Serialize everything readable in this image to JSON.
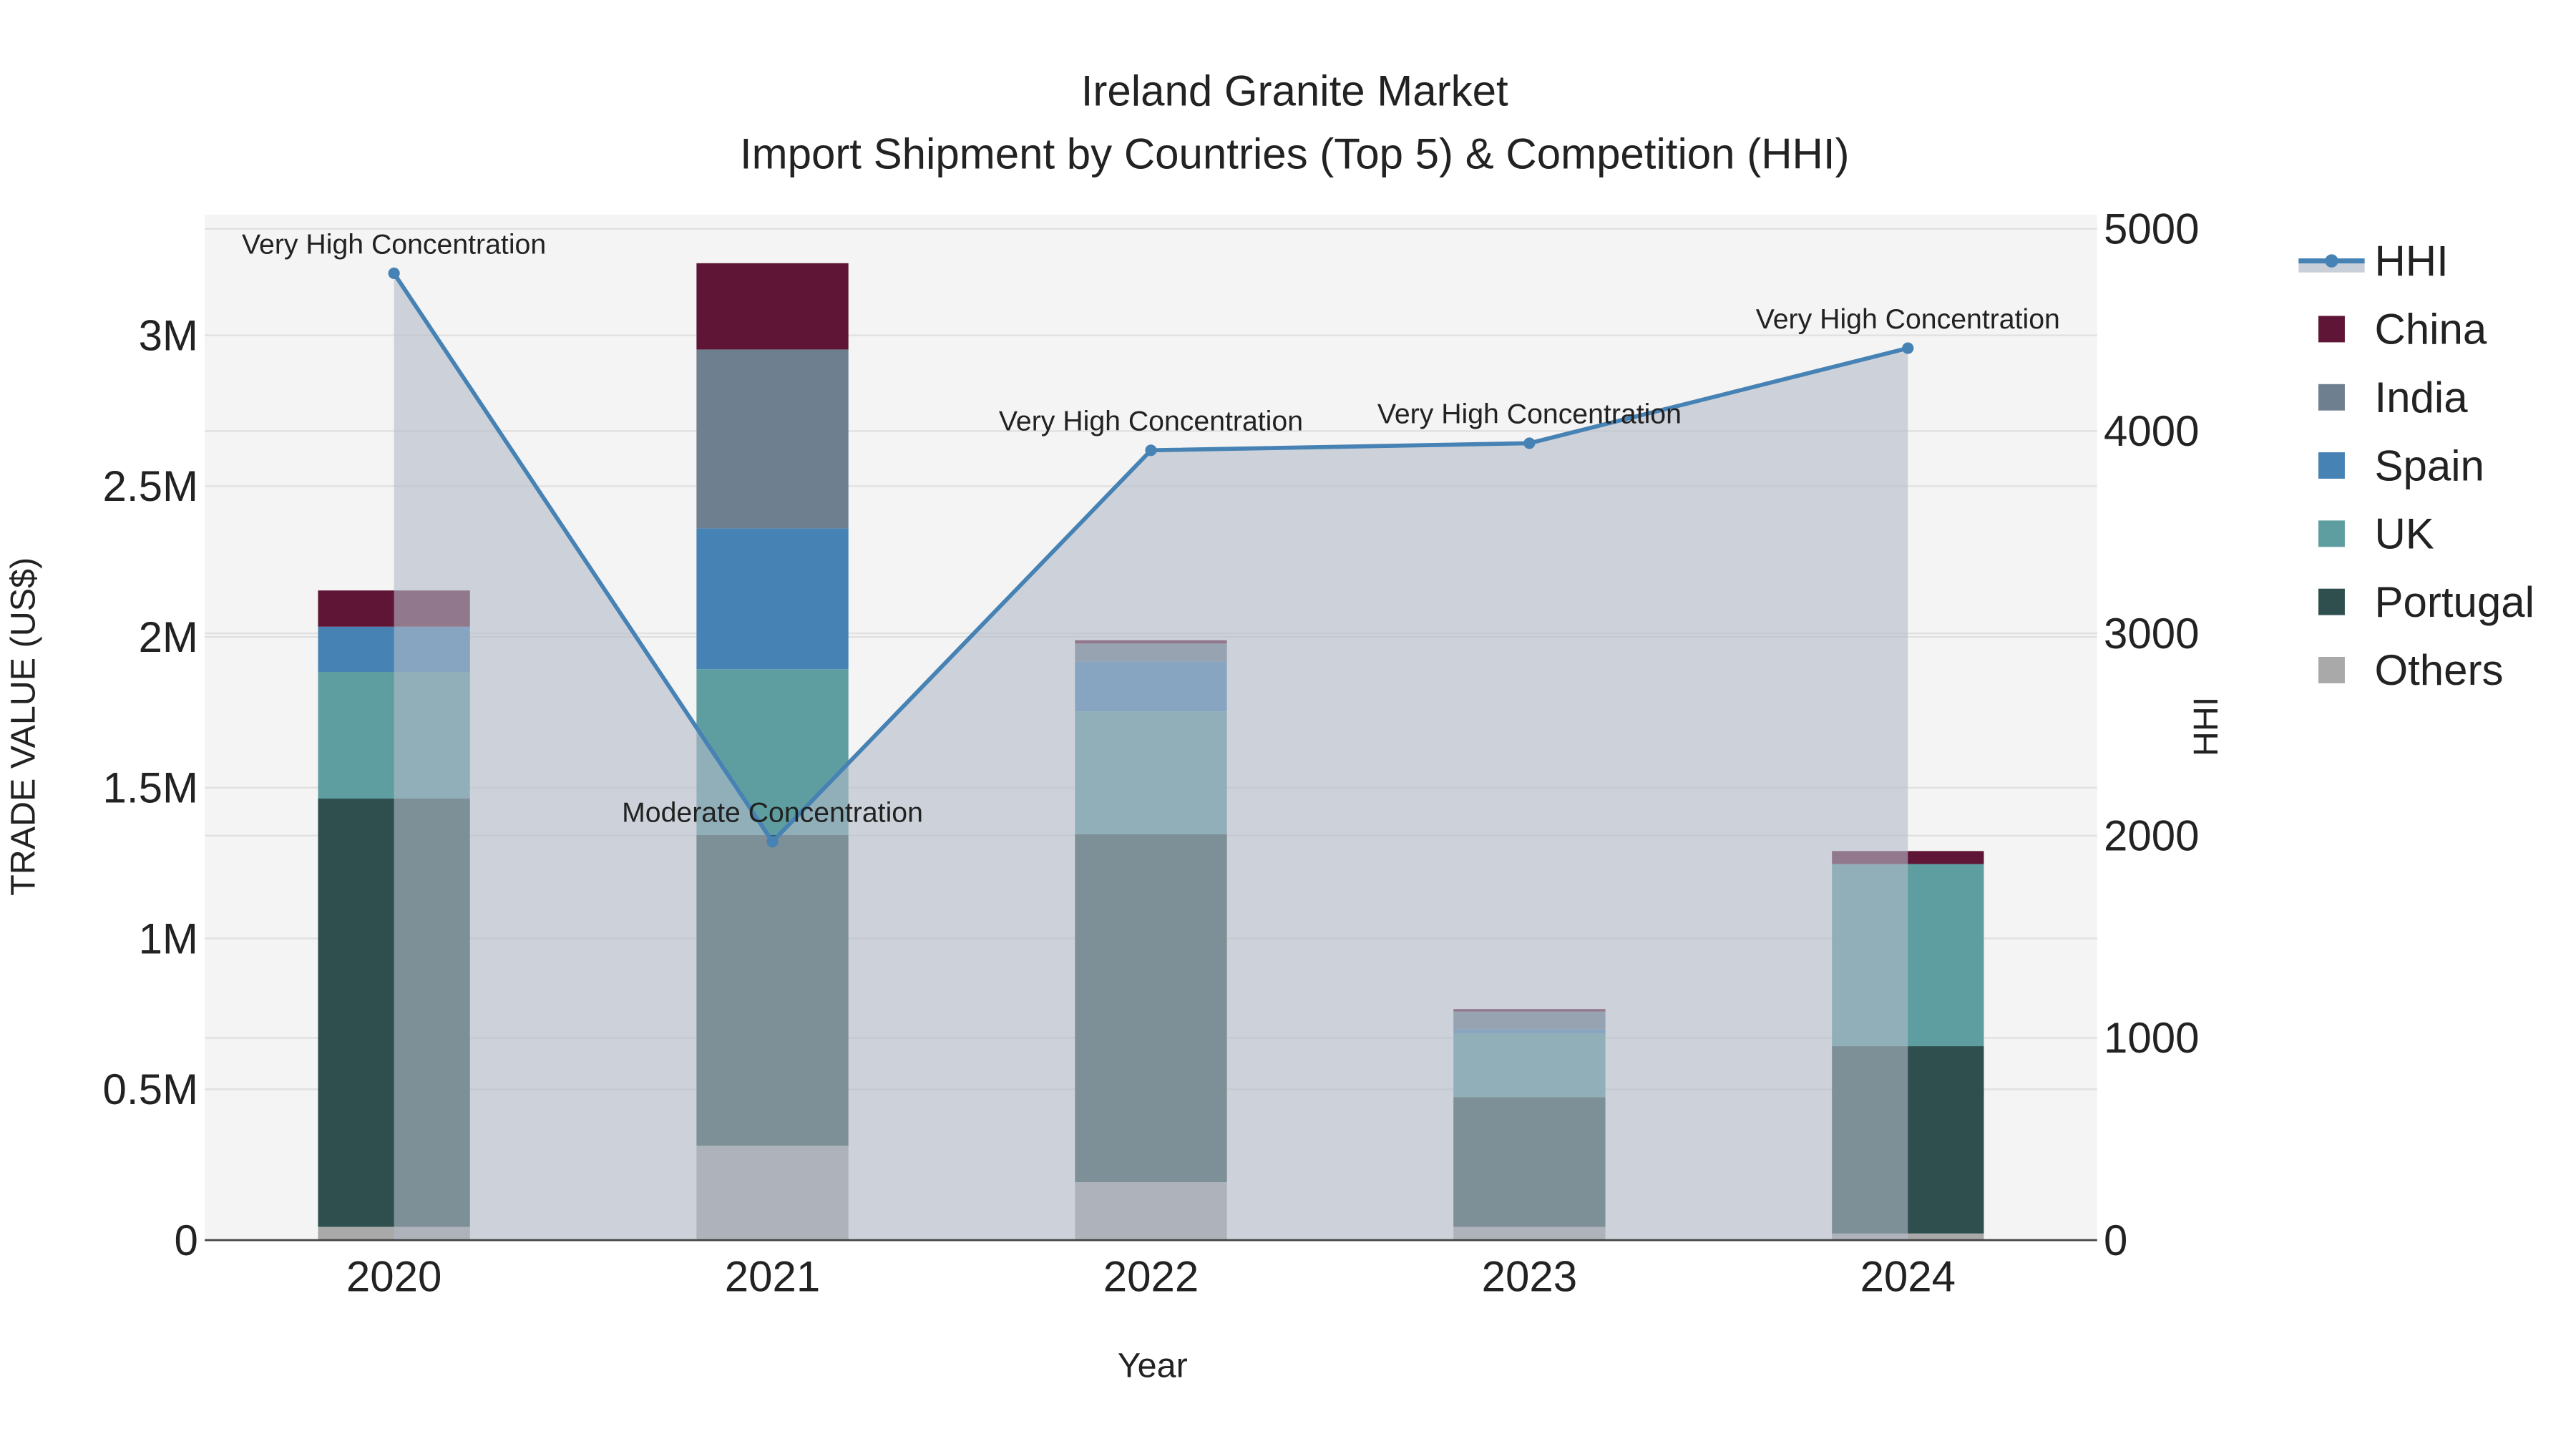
{
  "chart_data": {
    "type": "bar",
    "title": "Ireland Granite Market",
    "subtitle": "Import Shipment by Countries (Top 5) & Competition (HHI)",
    "xlabel": "Year",
    "ylabel": "TRADE VALUE (US$)",
    "y2label": "HHI",
    "categories": [
      "2020",
      "2021",
      "2022",
      "2023",
      "2024"
    ],
    "ylim": [
      0,
      3400000
    ],
    "y2lim": [
      0,
      5070
    ],
    "yticks": [
      {
        "v": 0,
        "label": "0"
      },
      {
        "v": 500000,
        "label": "0.5M"
      },
      {
        "v": 1000000,
        "label": "1M"
      },
      {
        "v": 1500000,
        "label": "1.5M"
      },
      {
        "v": 2000000,
        "label": "2M"
      },
      {
        "v": 2500000,
        "label": "2.5M"
      },
      {
        "v": 3000000,
        "label": "3M"
      }
    ],
    "y2ticks": [
      {
        "v": 0,
        "label": "0"
      },
      {
        "v": 1000,
        "label": "1000"
      },
      {
        "v": 2000,
        "label": "2000"
      },
      {
        "v": 3000,
        "label": "3000"
      },
      {
        "v": 4000,
        "label": "4000"
      },
      {
        "v": 5000,
        "label": "5000"
      }
    ],
    "stacked": true,
    "series": [
      {
        "name": "Others",
        "color": "#a9a9a9",
        "values": [
          44000,
          313000,
          192000,
          44000,
          22000
        ]
      },
      {
        "name": "Portugal",
        "color": "#2f4f4f",
        "values": [
          1420000,
          1030000,
          1154000,
          430000,
          621000
        ]
      },
      {
        "name": "UK",
        "color": "#5f9ea0",
        "values": [
          420000,
          550000,
          407000,
          212000,
          604000
        ]
      },
      {
        "name": "Spain",
        "color": "#4682b4",
        "values": [
          150000,
          467000,
          165000,
          12000,
          0
        ]
      },
      {
        "name": "India",
        "color": "#6e7f90",
        "values": [
          0,
          593000,
          60000,
          60000,
          0
        ]
      },
      {
        "name": "China",
        "color": "#5f1535",
        "values": [
          120000,
          286000,
          11000,
          8000,
          43000
        ]
      }
    ],
    "line": {
      "name": "HHI",
      "color": "#4682b4",
      "axis": "right",
      "values": [
        4780,
        1970,
        3905,
        3940,
        4410
      ],
      "annotations": [
        "Very High Concentration",
        "Moderate Concentration",
        "Very High Concentration",
        "Very High Concentration",
        "Very High Concentration"
      ]
    },
    "legend": {
      "position": "right",
      "order": [
        "HHI",
        "China",
        "India",
        "Spain",
        "UK",
        "Portugal",
        "Others"
      ]
    },
    "grid": true
  }
}
